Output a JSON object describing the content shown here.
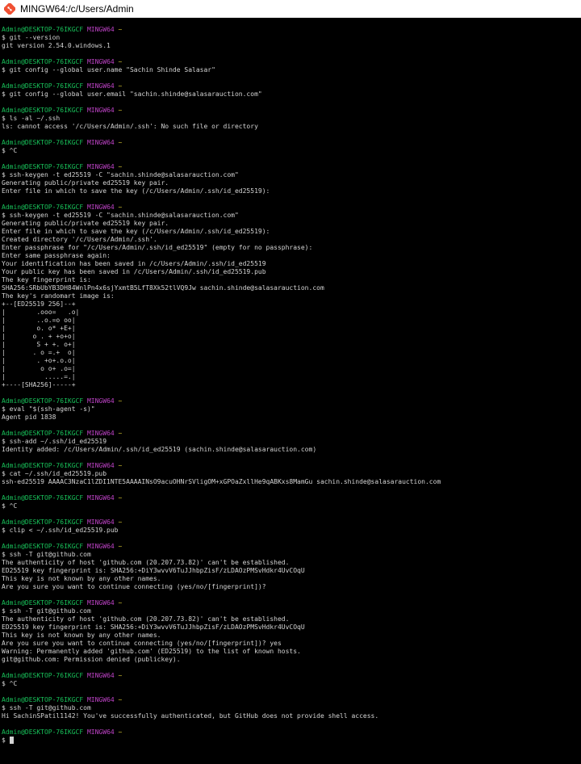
{
  "window": {
    "title": "MINGW64:/c/Users/Admin"
  },
  "terminal": {
    "lines": [
      {
        "kind": "prompt",
        "user": "Admin@DESKTOP-76IKGCF",
        "shell": "MINGW64",
        "dir": "~"
      },
      {
        "kind": "text",
        "text": "$ git --version"
      },
      {
        "kind": "text",
        "text": "git version 2.54.0.windows.1"
      },
      {
        "kind": "blank"
      },
      {
        "kind": "prompt",
        "user": "Admin@DESKTOP-76IKGCF",
        "shell": "MINGW64",
        "dir": "~"
      },
      {
        "kind": "text",
        "text": "$ git config --global user.name \"Sachin Shinde Salasar\""
      },
      {
        "kind": "blank"
      },
      {
        "kind": "prompt",
        "user": "Admin@DESKTOP-76IKGCF",
        "shell": "MINGW64",
        "dir": "~"
      },
      {
        "kind": "text",
        "text": "$ git config --global user.email \"sachin.shinde@salasarauction.com\""
      },
      {
        "kind": "blank"
      },
      {
        "kind": "prompt",
        "user": "Admin@DESKTOP-76IKGCF",
        "shell": "MINGW64",
        "dir": "~"
      },
      {
        "kind": "text",
        "text": "$ ls -al ~/.ssh"
      },
      {
        "kind": "text",
        "text": "ls: cannot access '/c/Users/Admin/.ssh': No such file or directory"
      },
      {
        "kind": "blank"
      },
      {
        "kind": "prompt",
        "user": "Admin@DESKTOP-76IKGCF",
        "shell": "MINGW64",
        "dir": "~"
      },
      {
        "kind": "text",
        "text": "$ ^C"
      },
      {
        "kind": "blank"
      },
      {
        "kind": "prompt",
        "user": "Admin@DESKTOP-76IKGCF",
        "shell": "MINGW64",
        "dir": "~"
      },
      {
        "kind": "text",
        "text": "$ ssh-keygen -t ed25519 -C \"sachin.shinde@salasarauction.com\""
      },
      {
        "kind": "text",
        "text": "Generating public/private ed25519 key pair."
      },
      {
        "kind": "text",
        "text": "Enter file in which to save the key (/c/Users/Admin/.ssh/id_ed25519):"
      },
      {
        "kind": "blank"
      },
      {
        "kind": "prompt",
        "user": "Admin@DESKTOP-76IKGCF",
        "shell": "MINGW64",
        "dir": "~"
      },
      {
        "kind": "text",
        "text": "$ ssh-keygen -t ed25519 -C \"sachin.shinde@salasarauction.com\""
      },
      {
        "kind": "text",
        "text": "Generating public/private ed25519 key pair."
      },
      {
        "kind": "text",
        "text": "Enter file in which to save the key (/c/Users/Admin/.ssh/id_ed25519):"
      },
      {
        "kind": "text",
        "text": "Created directory '/c/Users/Admin/.ssh'."
      },
      {
        "kind": "text",
        "text": "Enter passphrase for \"/c/Users/Admin/.ssh/id_ed25519\" (empty for no passphrase):"
      },
      {
        "kind": "text",
        "text": "Enter same passphrase again:"
      },
      {
        "kind": "text",
        "text": "Your identification has been saved in /c/Users/Admin/.ssh/id_ed25519"
      },
      {
        "kind": "text",
        "text": "Your public key has been saved in /c/Users/Admin/.ssh/id_ed25519.pub"
      },
      {
        "kind": "text",
        "text": "The key fingerprint is:"
      },
      {
        "kind": "text",
        "text": "SHA256:SRbUbYB3DH84WnlPn4x6sjYxmtB5LfT8Xk52tlVQ9Jw sachin.shinde@salasarauction.com"
      },
      {
        "kind": "text",
        "text": "The key's randomart image is:"
      },
      {
        "kind": "text",
        "text": "+--[ED25519 256]--+"
      },
      {
        "kind": "text",
        "text": "|        .ooo=   .o|"
      },
      {
        "kind": "text",
        "text": "|        ..o.=o oo|"
      },
      {
        "kind": "text",
        "text": "|        o. o* +E+|"
      },
      {
        "kind": "text",
        "text": "|       o . + +o+o|"
      },
      {
        "kind": "text",
        "text": "|        S + +. o+|"
      },
      {
        "kind": "text",
        "text": "|       . o =.+  o|"
      },
      {
        "kind": "text",
        "text": "|        . +o+.o.o|"
      },
      {
        "kind": "text",
        "text": "|         o o+ .o=|"
      },
      {
        "kind": "text",
        "text": "|          .....=.|"
      },
      {
        "kind": "text",
        "text": "+----[SHA256]-----+"
      },
      {
        "kind": "blank"
      },
      {
        "kind": "prompt",
        "user": "Admin@DESKTOP-76IKGCF",
        "shell": "MINGW64",
        "dir": "~"
      },
      {
        "kind": "text",
        "text": "$ eval \"$(ssh-agent -s)\""
      },
      {
        "kind": "text",
        "text": "Agent pid 1838"
      },
      {
        "kind": "blank"
      },
      {
        "kind": "prompt",
        "user": "Admin@DESKTOP-76IKGCF",
        "shell": "MINGW64",
        "dir": "~"
      },
      {
        "kind": "text",
        "text": "$ ssh-add ~/.ssh/id_ed25519"
      },
      {
        "kind": "text",
        "text": "Identity added: /c/Users/Admin/.ssh/id_ed25519 (sachin.shinde@salasarauction.com)"
      },
      {
        "kind": "blank"
      },
      {
        "kind": "prompt",
        "user": "Admin@DESKTOP-76IKGCF",
        "shell": "MINGW64",
        "dir": "~"
      },
      {
        "kind": "text",
        "text": "$ cat ~/.ssh/id_ed25519.pub"
      },
      {
        "kind": "text",
        "text": "ssh-ed25519 AAAAC3NzaC1lZDI1NTE5AAAAINsO9acuOHNrSVligOM+xGPOaZxllHe9qABKxs8MamGu sachin.shinde@salasarauction.com"
      },
      {
        "kind": "blank"
      },
      {
        "kind": "prompt",
        "user": "Admin@DESKTOP-76IKGCF",
        "shell": "MINGW64",
        "dir": "~"
      },
      {
        "kind": "text",
        "text": "$ ^C"
      },
      {
        "kind": "blank"
      },
      {
        "kind": "prompt",
        "user": "Admin@DESKTOP-76IKGCF",
        "shell": "MINGW64",
        "dir": "~"
      },
      {
        "kind": "text",
        "text": "$ clip < ~/.ssh/id_ed25519.pub"
      },
      {
        "kind": "blank"
      },
      {
        "kind": "prompt",
        "user": "Admin@DESKTOP-76IKGCF",
        "shell": "MINGW64",
        "dir": "~"
      },
      {
        "kind": "text",
        "text": "$ ssh -T git@github.com"
      },
      {
        "kind": "text",
        "text": "The authenticity of host 'github.com (20.207.73.82)' can't be established."
      },
      {
        "kind": "text",
        "text": "ED25519 key fingerprint is: SHA256:+DiY3wvvV6TuJJhbpZisF/zLDAOzPMSvHdkr4UvCOqU"
      },
      {
        "kind": "text",
        "text": "This key is not known by any other names."
      },
      {
        "kind": "text",
        "text": "Are you sure you want to continue connecting (yes/no/[fingerprint])?"
      },
      {
        "kind": "blank"
      },
      {
        "kind": "prompt",
        "user": "Admin@DESKTOP-76IKGCF",
        "shell": "MINGW64",
        "dir": "~"
      },
      {
        "kind": "text",
        "text": "$ ssh -T git@github.com"
      },
      {
        "kind": "text",
        "text": "The authenticity of host 'github.com (20.207.73.82)' can't be established."
      },
      {
        "kind": "text",
        "text": "ED25519 key fingerprint is: SHA256:+DiY3wvvV6TuJJhbpZisF/zLDAOzPMSvHdkr4UvCOqU"
      },
      {
        "kind": "text",
        "text": "This key is not known by any other names."
      },
      {
        "kind": "text",
        "text": "Are you sure you want to continue connecting (yes/no/[fingerprint])? yes"
      },
      {
        "kind": "text",
        "text": "Warning: Permanently added 'github.com' (ED25519) to the list of known hosts."
      },
      {
        "kind": "text",
        "text": "git@github.com: Permission denied (publickey)."
      },
      {
        "kind": "blank"
      },
      {
        "kind": "prompt",
        "user": "Admin@DESKTOP-76IKGCF",
        "shell": "MINGW64",
        "dir": "~"
      },
      {
        "kind": "text",
        "text": "$ ^C"
      },
      {
        "kind": "blank"
      },
      {
        "kind": "prompt",
        "user": "Admin@DESKTOP-76IKGCF",
        "shell": "MINGW64",
        "dir": "~"
      },
      {
        "kind": "text",
        "text": "$ ssh -T git@github.com"
      },
      {
        "kind": "text",
        "text": "Hi SachinSPatil1142! You've successfully authenticated, but GitHub does not provide shell access."
      },
      {
        "kind": "blank"
      },
      {
        "kind": "prompt",
        "user": "Admin@DESKTOP-76IKGCF",
        "shell": "MINGW64",
        "dir": "~"
      },
      {
        "kind": "cursor",
        "text": "$ "
      }
    ]
  }
}
